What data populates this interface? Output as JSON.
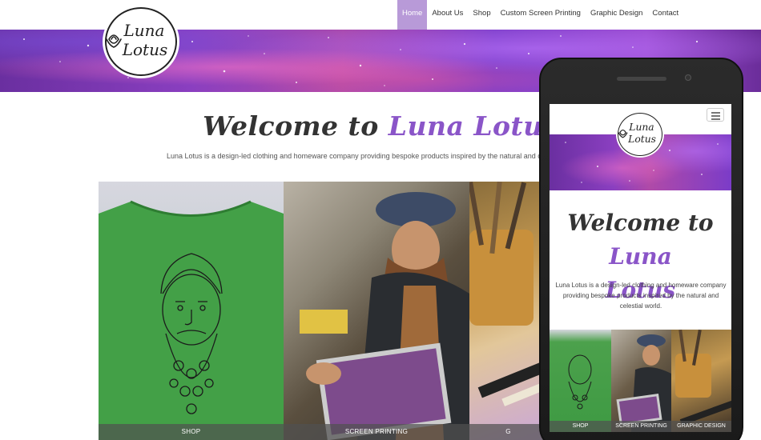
{
  "site": {
    "logo_text": "Luna Lotus",
    "nav": [
      {
        "label": "Home",
        "active": true
      },
      {
        "label": "About Us",
        "active": false
      },
      {
        "label": "Shop",
        "active": false
      },
      {
        "label": "Custom Screen Printing",
        "active": false
      },
      {
        "label": "Graphic Design",
        "active": false
      },
      {
        "label": "Contact",
        "active": false
      }
    ],
    "welcome_prefix": "Welcome to ",
    "welcome_brand": "Luna Lotus",
    "intro": "Luna Lotus is a design-led clothing and homeware company providing bespoke products inspired by the natural and c",
    "tiles": [
      {
        "caption": "SHOP"
      },
      {
        "caption": "SCREEN PRINTING"
      },
      {
        "caption": "G"
      }
    ]
  },
  "mobile": {
    "welcome_prefix": "Welcome to ",
    "welcome_brand_1": "Luna",
    "welcome_brand_2": "Lotus",
    "intro": "Luna Lotus is a design-led clothing and homeware company providing bespoke products inspired by the natural and celestial world.",
    "tiles": [
      {
        "caption": "SHOP"
      },
      {
        "caption": "SCREEN PRINTING"
      },
      {
        "caption": "GRAPHIC DESIGN"
      }
    ]
  },
  "colors": {
    "accent": "#8a55c8",
    "nav_active_bg": "#b89ad8",
    "tile_caption_bg": "#505050"
  },
  "icons": {
    "menu": "hamburger-menu-icon",
    "logo": "lotus-logo"
  }
}
